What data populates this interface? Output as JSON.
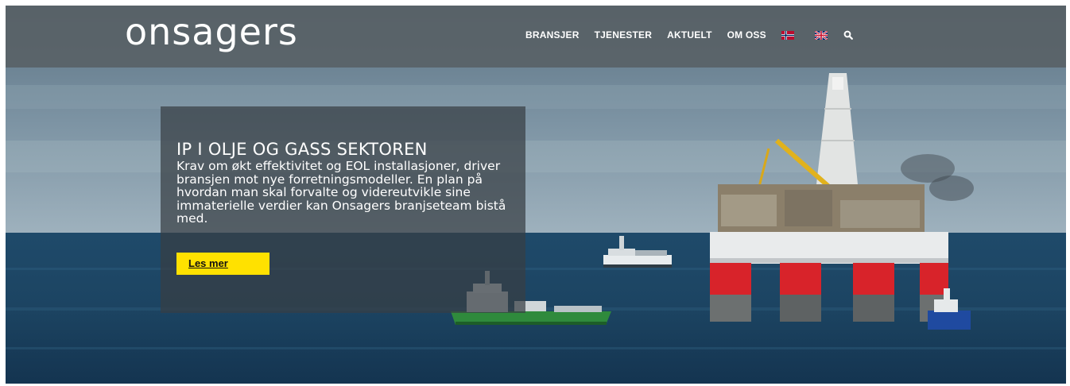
{
  "header": {
    "logo_text": "onsagers",
    "nav": [
      {
        "label": "BRANSJER"
      },
      {
        "label": "TJENESTER"
      },
      {
        "label": "AKTUELT"
      },
      {
        "label": "OM OSS"
      }
    ],
    "icons": [
      "norwegian-flag-icon",
      "uk-flag-icon",
      "search-icon"
    ]
  },
  "hero": {
    "headline": "IP I OLJE OG GASS SEKTOREN",
    "body": "Krav om økt effektivitet og EOL installasjoner, driver bransjen mot nye forretningsmodeller. En plan på hvordan man skal forvalte og videreutvikle sine immaterielle verdier kan Onsagers branjseteam bistå med.",
    "cta_label": "Les mer"
  },
  "colors": {
    "header_bg": "#5a6266",
    "cta_bg": "#ffe100",
    "textbox_bg": "#373e44",
    "rig_red": "#d8232a"
  }
}
